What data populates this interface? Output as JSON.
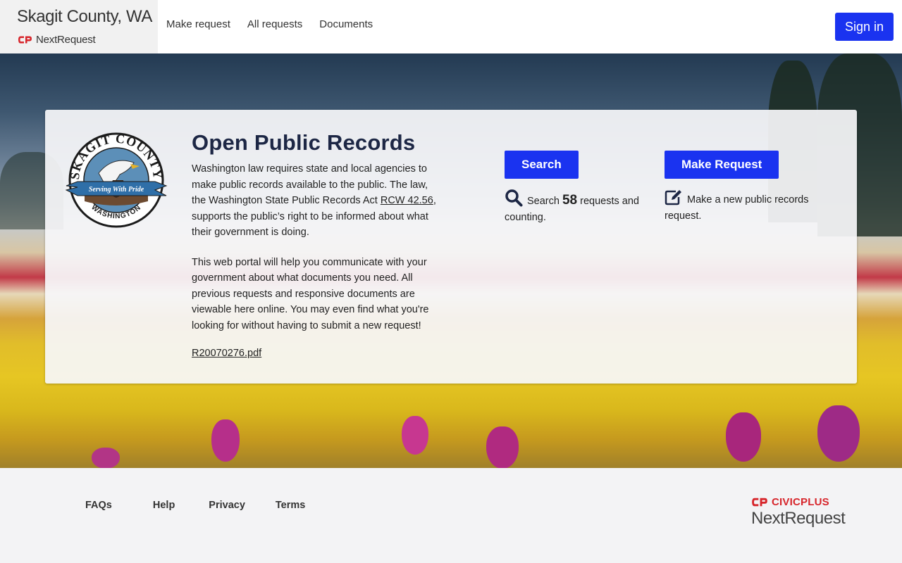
{
  "header": {
    "agency_name": "Skagit County, WA",
    "logo_text": "NextRequest",
    "nav": [
      "Make request",
      "All requests",
      "Documents"
    ],
    "sign_in": "Sign in"
  },
  "seal": {
    "top_text": "SKAGIT COUNTY",
    "banner_text": "Serving With Pride",
    "bottom_text": "WASHINGTON"
  },
  "intro": {
    "title": "Open Public Records",
    "p1_before": "Washington law requires state and local agencies to make public records available to the public. The law, the Washington State Public Records Act ",
    "p1_link": "RCW 42.56",
    "p1_after": ", supports the public’s right to be informed about what their government is doing.",
    "p2": "This web portal will help you communicate with your government about what documents you need. All previous requests and responsive documents are viewable here online. You may even find what you're looking for without having to submit a new request!",
    "doc_link": "R20070276.pdf"
  },
  "search": {
    "button": "Search",
    "desc_before": "Search ",
    "count": "58",
    "desc_after": " requests and counting."
  },
  "make_request": {
    "button": "Make Request",
    "desc": "Make a new public records request."
  },
  "footer": {
    "links": [
      "FAQs",
      "Help",
      "Privacy",
      "Terms"
    ],
    "brand_top": "CIVICPLUS",
    "brand_bottom": "NextRequest"
  },
  "colors": {
    "primary": "#1a33f0",
    "title": "#1d2745",
    "brand_red": "#d7252b"
  }
}
